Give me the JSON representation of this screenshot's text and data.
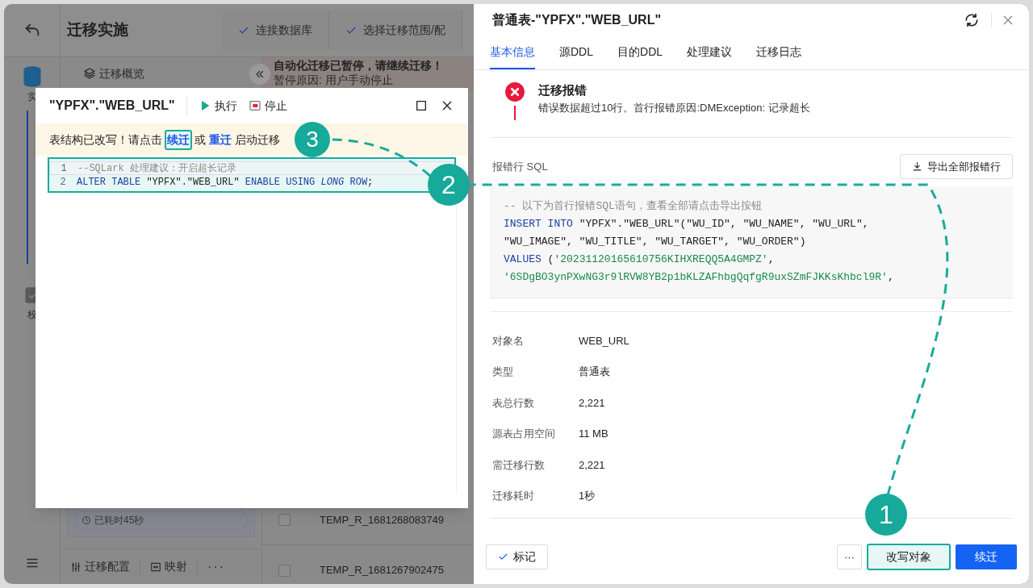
{
  "background_app": {
    "title": "迁移实施",
    "steps": [
      {
        "label": "连接数据库",
        "done": true
      },
      {
        "label": "选择迁移范围/配",
        "done": true
      }
    ],
    "rail": [
      {
        "label": "实",
        "selected": true
      },
      {
        "label": "校",
        "selected": false
      }
    ],
    "overview_label": "迁移概览",
    "elapsed": "已耗时45秒",
    "bottom_actions": [
      {
        "kind": "config",
        "label": "迁移配置"
      },
      {
        "kind": "mapping",
        "label": "映射"
      },
      {
        "kind": "more",
        "label": "···"
      }
    ],
    "notice": {
      "title": "自动化迁移已暂停，请继续迁移！",
      "reason": "暂停原因: 用户手动停止"
    },
    "rows": [
      {
        "name": "TEMP_R_1681268083749",
        "checked": false
      },
      {
        "name": "TEMP_R_1681267902475",
        "checked": false
      }
    ]
  },
  "dialog": {
    "title": "\"YPFX\".\"WEB_URL\"",
    "toolbar": [
      {
        "kind": "run",
        "label": "执行"
      },
      {
        "kind": "stop",
        "label": "停止"
      }
    ],
    "notice": [
      {
        "kind": "text",
        "text": "表结构已改写！请点击"
      },
      {
        "kind": "link",
        "text": "续迁",
        "highlighted": true
      },
      {
        "kind": "text",
        "text": "或"
      },
      {
        "kind": "link",
        "text": "重迁",
        "highlighted": false
      },
      {
        "kind": "text",
        "text": "启动迁移"
      }
    ],
    "code_highlighted": true,
    "code": [
      {
        "number": "1",
        "tokens": [
          {
            "kind": "comment",
            "text": "--SQLark 处理建议：开启超长记录"
          }
        ]
      },
      {
        "number": "2",
        "tokens": [
          {
            "kind": "keyword",
            "text": "ALTER TABLE"
          },
          {
            "kind": "plain",
            "text": " \"YPFX\".\"WEB_URL\" "
          },
          {
            "kind": "keyword",
            "text": "ENABLE USING "
          },
          {
            "kind": "keyword_italic",
            "text": "LONG"
          },
          {
            "kind": "keyword",
            "text": " ROW"
          },
          {
            "kind": "plain",
            "text": ";"
          }
        ]
      }
    ]
  },
  "drawer": {
    "title": "普通表-\"YPFX\".\"WEB_URL\"",
    "tabs": [
      {
        "label": "基本信息",
        "selected": true
      },
      {
        "label": "源DDL",
        "selected": false
      },
      {
        "label": "目的DDL",
        "selected": false
      },
      {
        "label": "处理建议",
        "selected": false
      },
      {
        "label": "迁移日志",
        "selected": false
      }
    ],
    "error": {
      "title": "迁移报错",
      "message": "错误数据超过10行。首行报错原因:DMException: 记录超长"
    },
    "sql_label": "报错行 SQL",
    "export_button": "导出全部报错行",
    "sql": [
      {
        "tokens": [
          {
            "kind": "comment",
            "text": "-- 以下为首行报错SQL语句，查看全部请点击导出按钮"
          }
        ]
      },
      {
        "tokens": [
          {
            "kind": "keyword",
            "text": "INSERT INTO"
          },
          {
            "kind": "plain",
            "text": " \"YPFX\".\"WEB_URL\"(\"WU_ID\", \"WU_NAME\", \"WU_URL\","
          }
        ]
      },
      {
        "tokens": [
          {
            "kind": "plain",
            "text": "\"WU_IMAGE\", \"WU_TITLE\", \"WU_TARGET\", \"WU_ORDER\")"
          }
        ]
      },
      {
        "tokens": [
          {
            "kind": "keyword",
            "text": "VALUES"
          },
          {
            "kind": "plain",
            "text": " ("
          },
          {
            "kind": "string",
            "text": "'20231120165610756KIHXREQQ5A4GMPZ'"
          },
          {
            "kind": "plain",
            "text": ","
          }
        ]
      },
      {
        "tokens": [
          {
            "kind": "string",
            "text": "'6SDgBO3ynPXwNG3r9lRVW8YB2p1bKLZAFhbgQqfgR9uxSZmFJKKsKhbcl9R'"
          },
          {
            "kind": "plain",
            "text": ","
          }
        ]
      }
    ],
    "properties": [
      {
        "label": "对象名",
        "value": "WEB_URL"
      },
      {
        "label": "类型",
        "value": "普通表"
      },
      {
        "label": "表总行数",
        "value": "2,221"
      },
      {
        "label": "源表占用空间",
        "value": "11 MB"
      },
      {
        "label": "需迁移行数",
        "value": "2,221"
      },
      {
        "label": "迁移耗时",
        "value": "1秒"
      }
    ],
    "footer": {
      "mark": "标记",
      "more": "···",
      "rewrite": "改写对象",
      "rewrite_highlighted": true,
      "continue": "续迁"
    }
  },
  "annotations": [
    {
      "label": "1"
    },
    {
      "label": "2"
    },
    {
      "label": "3"
    }
  ]
}
